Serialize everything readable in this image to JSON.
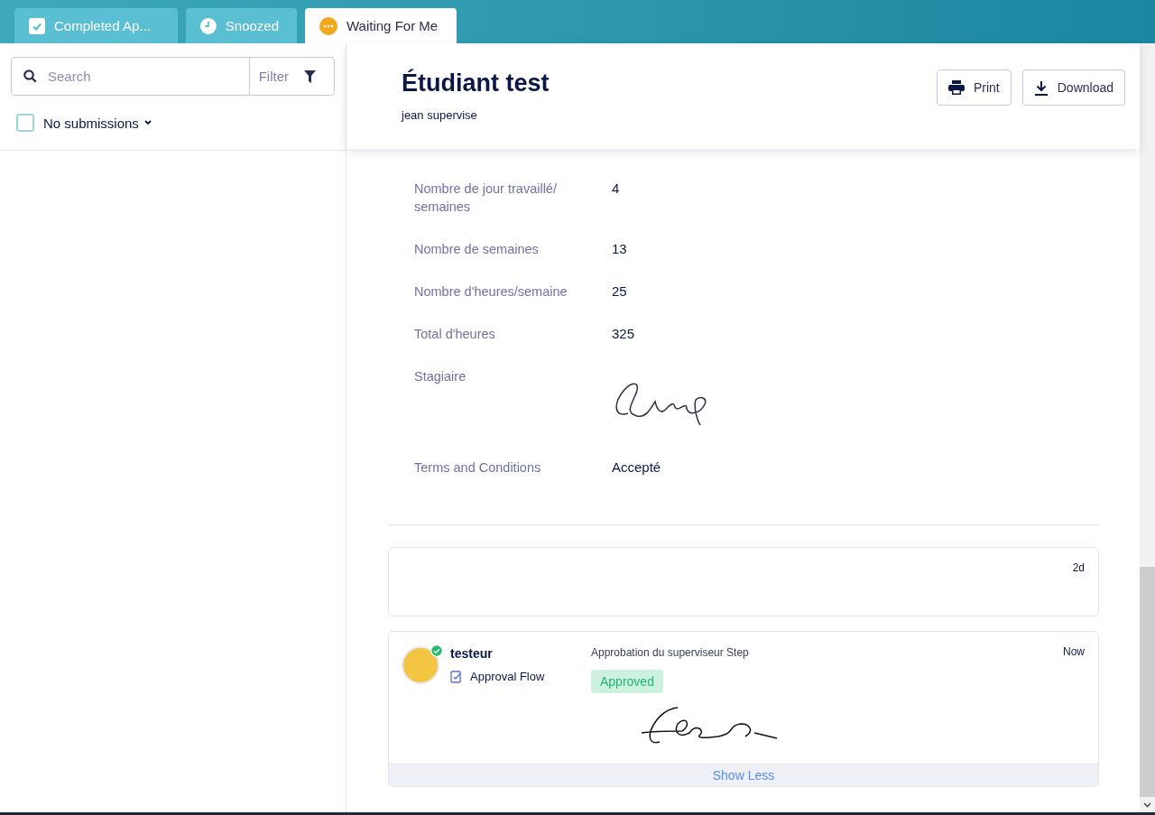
{
  "tabs": [
    {
      "label": "Completed Ap...",
      "kind": "check",
      "selected": false
    },
    {
      "label": "Snoozed",
      "kind": "clock",
      "selected": false
    },
    {
      "label": "Waiting For Me",
      "kind": "dots",
      "selected": true
    }
  ],
  "sidebar": {
    "search": {
      "placeholder": "Search"
    },
    "filter_button": "Filter",
    "select_all": {
      "label": "No submissions",
      "checked": false
    }
  },
  "header": {
    "title": "Étudiant test",
    "subtitle": "jean supervise",
    "buttons": [
      {
        "label": "Print",
        "kind": "print"
      },
      {
        "label": "Download",
        "kind": "download"
      }
    ]
  },
  "fields": [
    {
      "kind": "text",
      "label": "Nombre de jour travaillé/ semaines",
      "value": "4"
    },
    {
      "kind": "text",
      "label": "Nombre de semaines",
      "value": "13"
    },
    {
      "kind": "text",
      "label": "Nombre d'heures/semaine",
      "value": "25"
    },
    {
      "kind": "text",
      "label": "Total d'heures",
      "value": "325"
    },
    {
      "kind": "signature",
      "label": "Stagiaire"
    },
    {
      "kind": "text",
      "label": "Terms and Conditions",
      "value": "Accepté"
    }
  ],
  "activity": [
    {
      "kind": "empty",
      "time": "2d"
    },
    {
      "kind": "approval",
      "user": "testeur",
      "verified": true,
      "flow": "Approval Flow",
      "step": "Approbation du superviseur Step",
      "status": "Approved",
      "time": "Now",
      "toggle": "Show Less"
    }
  ]
}
